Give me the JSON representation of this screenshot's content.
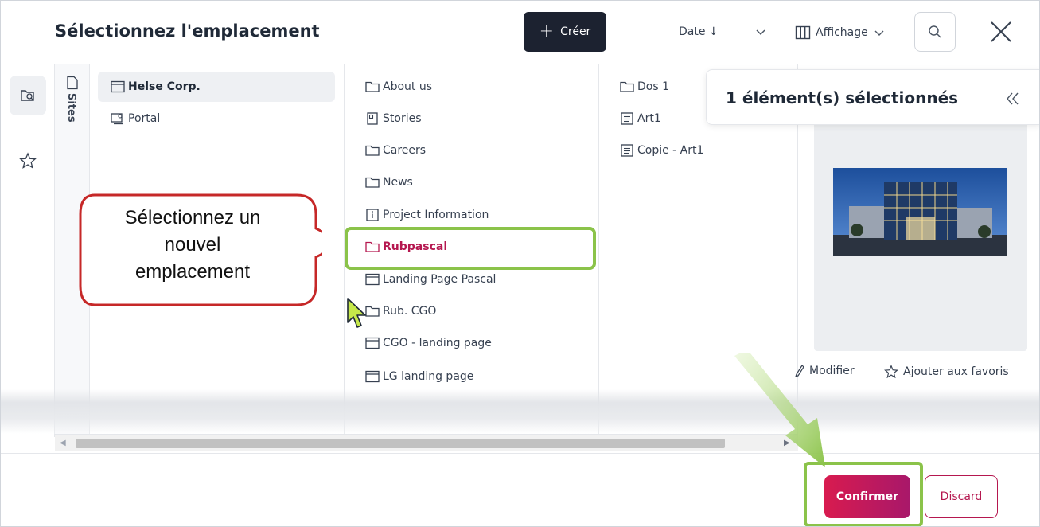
{
  "header": {
    "title": "Sélectionnez l'emplacement",
    "create_label": "Créer",
    "sort_label": "Date ↓",
    "view_label": "Affichage"
  },
  "rail": {
    "icons": [
      "browse-icon",
      "favorites-star-icon"
    ]
  },
  "sites_tab": {
    "label": "Sites"
  },
  "columns": {
    "sites": [
      {
        "label": "Helse Corp.",
        "icon": "page-icon",
        "selected": true
      },
      {
        "label": "Portal",
        "icon": "portal-icon",
        "selected": false
      }
    ],
    "sections": [
      {
        "label": "About us",
        "icon": "folder-icon"
      },
      {
        "label": "Stories",
        "icon": "storyboard-icon"
      },
      {
        "label": "Careers",
        "icon": "folder-icon"
      },
      {
        "label": "News",
        "icon": "folder-icon"
      },
      {
        "label": "Project Information",
        "icon": "info-icon"
      },
      {
        "label": "Rubpascal",
        "icon": "folder-icon",
        "highlighted": true
      },
      {
        "label": "Landing Page Pascal",
        "icon": "page-icon"
      },
      {
        "label": "Rub. CGO",
        "icon": "folder-icon"
      },
      {
        "label": "CGO - landing page",
        "icon": "page-icon"
      },
      {
        "label": "LG landing page",
        "icon": "page-icon"
      }
    ],
    "contents": [
      {
        "label": "Dos 1",
        "icon": "folder-icon"
      },
      {
        "label": "Art1",
        "icon": "article-icon"
      },
      {
        "label": "Copie - Art1",
        "icon": "article-icon"
      }
    ]
  },
  "selection_panel": {
    "text": "1 élément(s) sélectionnés"
  },
  "detail": {
    "modify_label": "Modifier",
    "favorite_label": "Ajouter aux favoris"
  },
  "footer": {
    "confirm_label": "Confirmer",
    "discard_label": "Discard"
  },
  "annotation": {
    "callout_lines": [
      "Sélectionnez un",
      "nouvel",
      "emplacement"
    ]
  },
  "colors": {
    "accent": "#b5174f",
    "highlight": "#8bc34a",
    "dark_button": "#1c2230"
  }
}
